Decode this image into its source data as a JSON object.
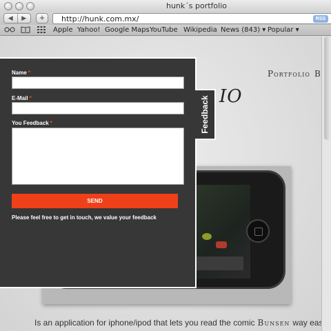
{
  "window": {
    "title": "hunk´s portfolio"
  },
  "toolbar": {
    "back": "◀",
    "forward": "▶",
    "add": "+",
    "url": "http://hunk.com.mx/",
    "rss": "RSS"
  },
  "bookmarks": {
    "icons": [
      "reader-glasses-icon",
      "book-icon",
      "grid-icon"
    ],
    "items": [
      "Apple",
      "Yahoo!",
      "Google Maps",
      "YouTube",
      "Wikipedia",
      "News (843) ▾",
      "Popular ▾"
    ]
  },
  "page": {
    "nav": [
      "Portfolio",
      "Blog"
    ],
    "heading_fragment": "IO",
    "body_text": "Is an application for iphone/ipod that lets you read the comic",
    "comic_name": "Bunsen",
    "body_text_tail": "way easily"
  },
  "feedback": {
    "tab_label": "Feedback",
    "name_label": "Name",
    "email_label": "E-Mail",
    "message_label": "You Feedback",
    "required_mark": "*",
    "name_value": "",
    "email_value": "",
    "message_value": "",
    "send_label": "SEND",
    "note": "Please feel free to get in touch, we value your feedback",
    "accent_color": "#f0401a"
  }
}
